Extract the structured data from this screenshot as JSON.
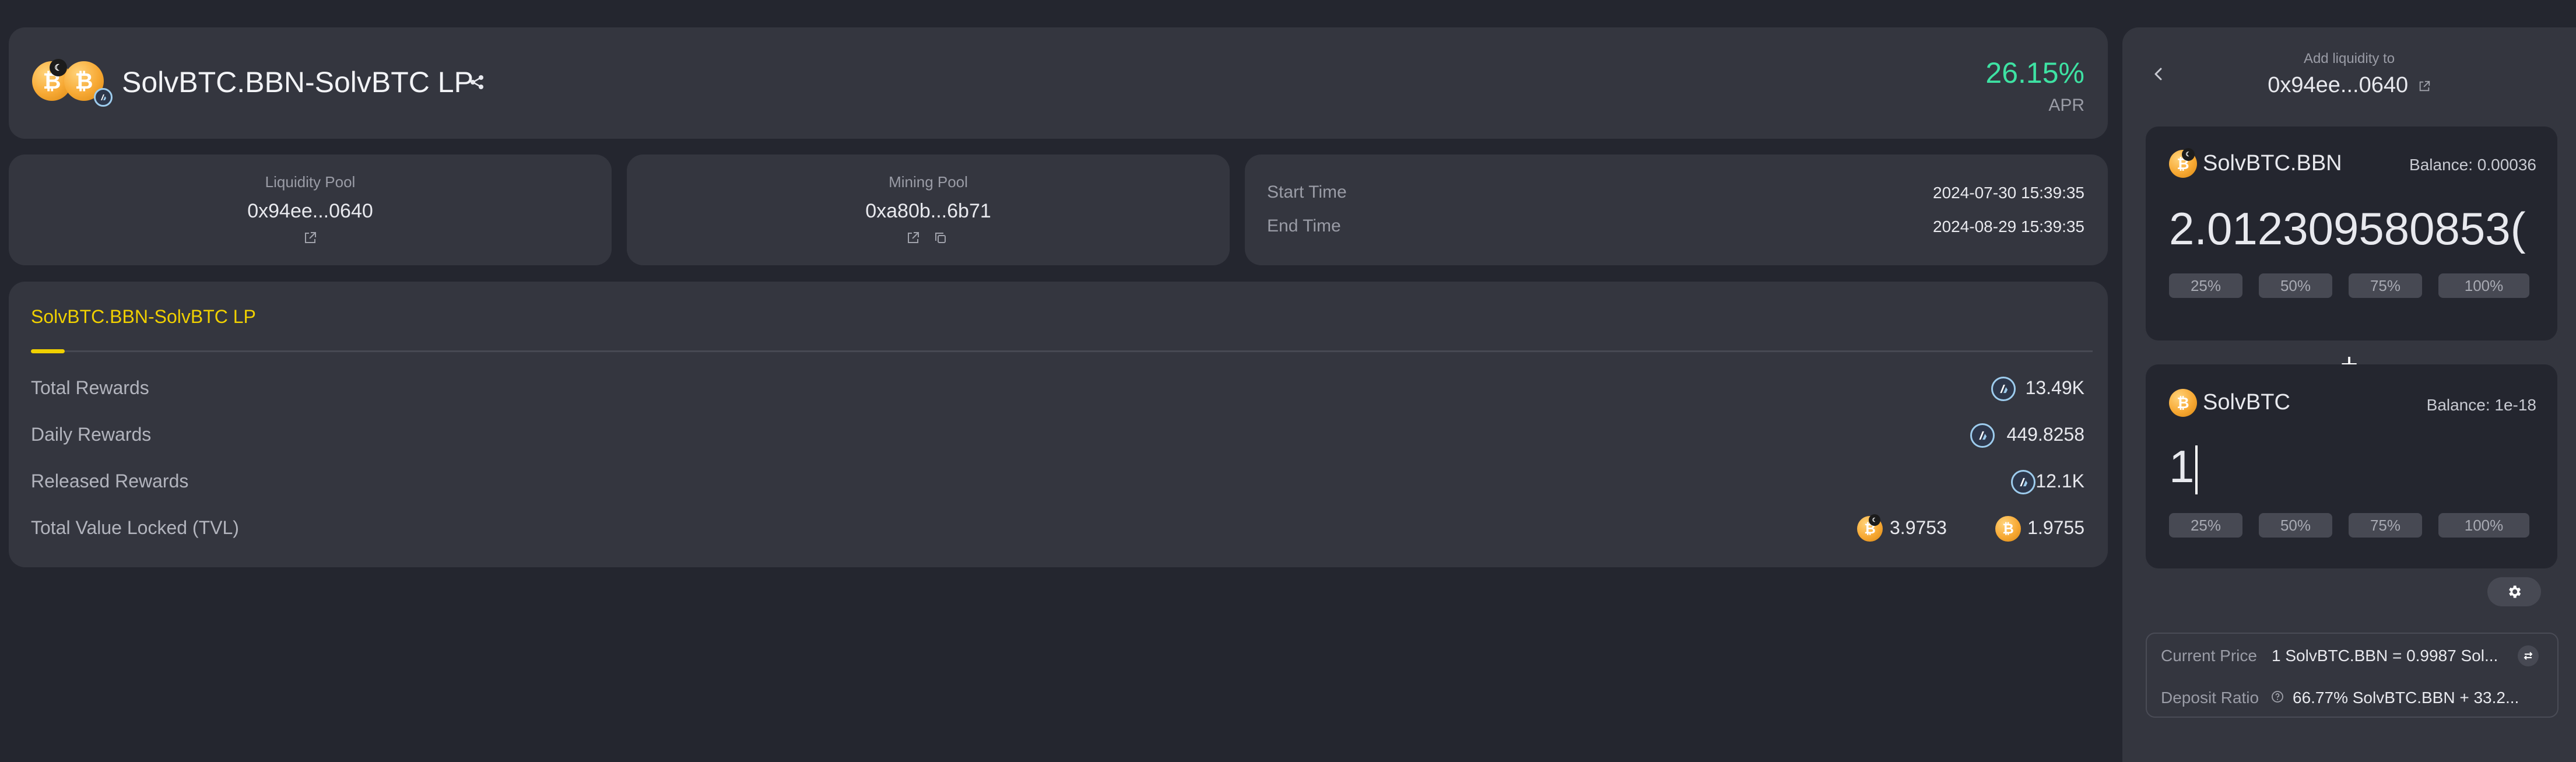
{
  "header": {
    "title": "SolvBTC.BBN-SolvBTC LP",
    "apr_value": "26.15%",
    "apr_label": "APR"
  },
  "info": {
    "liquidity_pool_label": "Liquidity Pool",
    "liquidity_pool_address": "0x94ee...0640",
    "mining_pool_label": "Mining Pool",
    "mining_pool_address": "0xa80b...6b71",
    "start_time_label": "Start Time",
    "start_time_value": "2024-07-30 15:39:35",
    "end_time_label": "End Time",
    "end_time_value": "2024-08-29 15:39:35"
  },
  "rewards": {
    "tab_label": "SolvBTC.BBN-SolvBTC LP",
    "rows": [
      {
        "label": "Total Rewards",
        "value": "13.49K"
      },
      {
        "label": "Daily Rewards",
        "value": "449.8258"
      },
      {
        "label": "Released Rewards",
        "value": "12.1K"
      }
    ],
    "tvl_label": "Total Value Locked (TVL)",
    "tvl_value_1": "3.9753",
    "tvl_value_2": "1.9755"
  },
  "add_liquidity": {
    "title": "Add liquidity to",
    "address": "0x94ee...0640",
    "token1": {
      "name": "SolvBTC.BBN",
      "balance": "Balance: 0.00036",
      "amount": "2.012309580853("
    },
    "plus": "+",
    "token2": {
      "name": "SolvBTC",
      "balance": "Balance: 1e-18",
      "amount": "1"
    },
    "pct_buttons": [
      "25%",
      "50%",
      "75%",
      "100%"
    ],
    "current_price_label": "Current Price",
    "current_price_value": "1 SolvBTC.BBN = 0.9987 Sol...",
    "deposit_ratio_label": "Deposit Ratio",
    "deposit_ratio_value": "66.77% SolvBTC.BBN + 33.2..."
  },
  "colors": {
    "background": "#24262f",
    "card": "#34363f",
    "accent_yellow": "#f0d000",
    "apr_green": "#3ee2a3",
    "coin_orange": "#f7a934"
  }
}
